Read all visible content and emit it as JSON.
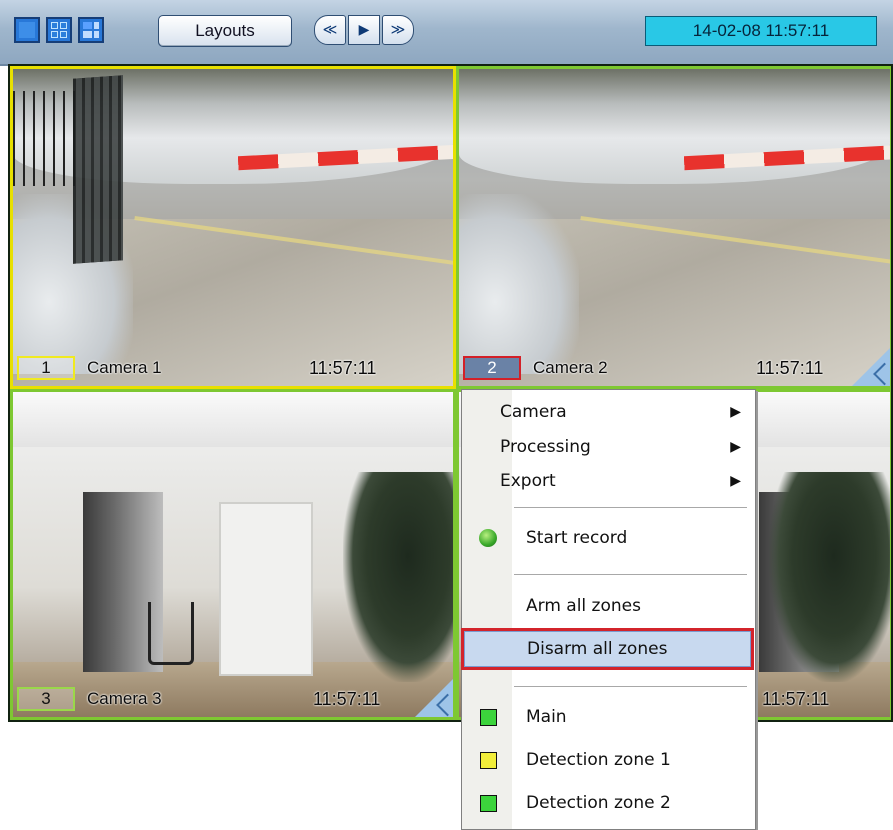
{
  "toolbar": {
    "layout_buttons": [
      "single-view",
      "grid-2x2",
      "grid-6"
    ],
    "layouts_label": "Layouts",
    "nav": {
      "prev": "≪",
      "play": "▶",
      "next": "≫"
    },
    "datetime": "14-02-08  11:57:11",
    "colors": {
      "datetime_bg": "#29c8e6",
      "bar": "#9fb6cc"
    }
  },
  "cameras": [
    {
      "number": "1",
      "name": "Camera 1",
      "time": "11:57:11",
      "border": "#e8e000"
    },
    {
      "number": "2",
      "name": "Camera 2",
      "time": "11:57:11",
      "border": "#7ec832"
    },
    {
      "number": "3",
      "name": "Camera 3",
      "time": "11:57:11",
      "border": "#7ec832"
    },
    {
      "number": "",
      "name": "",
      "time": "11:57:11",
      "border": "#7ec832"
    }
  ],
  "menu": {
    "camera": "Camera",
    "processing": "Processing",
    "export": "Export",
    "start_record": "Start record",
    "arm_all": "Arm all zones",
    "disarm_all": "Disarm all zones",
    "zones": [
      {
        "label": "Main",
        "color": "#3cd43c"
      },
      {
        "label": "Detection zone 1",
        "color": "#f2ee3a"
      },
      {
        "label": "Detection zone 2",
        "color": "#3cd43c"
      }
    ],
    "submenu_arrow": "▶"
  }
}
